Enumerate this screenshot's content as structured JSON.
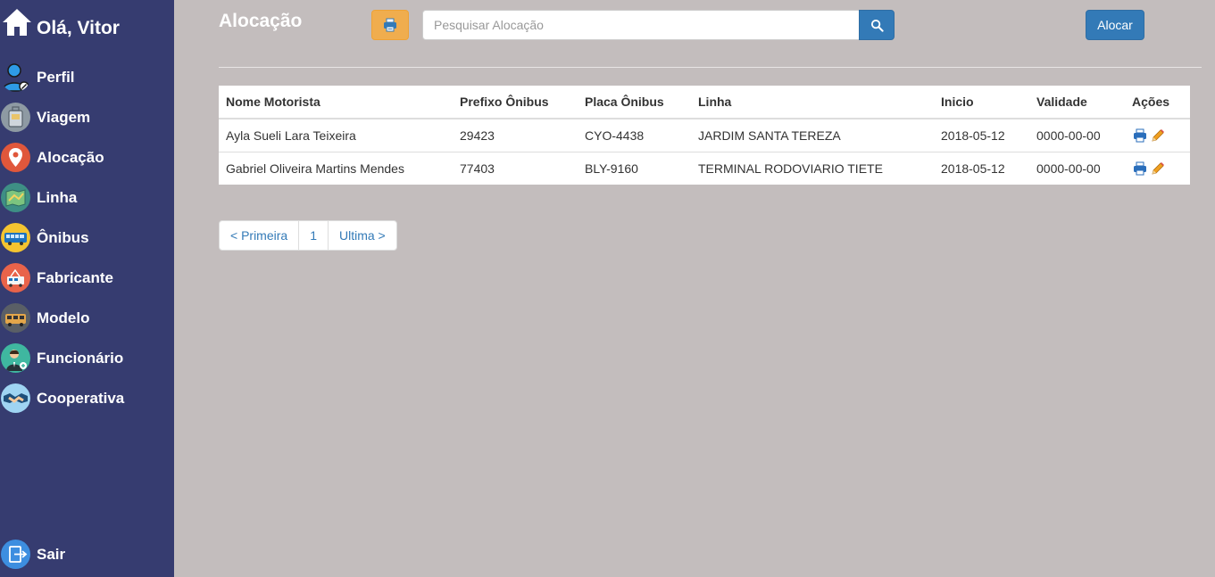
{
  "sidebar": {
    "greeting": "Olá, Vitor",
    "items": [
      {
        "label": "Perfil",
        "icon": "user-icon"
      },
      {
        "label": "Viagem",
        "icon": "luggage-icon"
      },
      {
        "label": "Alocação",
        "icon": "location-pin-icon"
      },
      {
        "label": "Linha",
        "icon": "map-icon"
      },
      {
        "label": "Ônibus",
        "icon": "bus-icon"
      },
      {
        "label": "Fabricante",
        "icon": "factory-icon"
      },
      {
        "label": "Modelo",
        "icon": "van-icon"
      },
      {
        "label": "Funcionário",
        "icon": "employee-icon"
      },
      {
        "label": "Cooperativa",
        "icon": "handshake-icon"
      }
    ],
    "logout_label": "Sair"
  },
  "header": {
    "title": "Alocação",
    "search_placeholder": "Pesquisar Alocação",
    "alocar_label": "Alocar"
  },
  "table": {
    "headers": [
      "Nome Motorista",
      "Prefixo Ônibus",
      "Placa Ônibus",
      "Linha",
      "Inicio",
      "Validade",
      "Ações"
    ],
    "rows": [
      {
        "motorista": "Ayla Sueli Lara Teixeira",
        "prefixo": "29423",
        "placa": "CYO-4438",
        "linha": "JARDIM SANTA TEREZA",
        "inicio": "2018-05-12",
        "validade": "0000-00-00"
      },
      {
        "motorista": "Gabriel Oliveira Martins Mendes",
        "prefixo": "77403",
        "placa": "BLY-9160",
        "linha": "TERMINAL RODOVIARIO TIETE",
        "inicio": "2018-05-12",
        "validade": "0000-00-00"
      }
    ]
  },
  "pagination": {
    "first": "< Primeira",
    "page": "1",
    "last": "Ultima >"
  },
  "colors": {
    "sidebar_bg": "#363c70",
    "page_bg": "#c3bdbd",
    "primary": "#337ab7",
    "warning": "#f0ad4e"
  }
}
